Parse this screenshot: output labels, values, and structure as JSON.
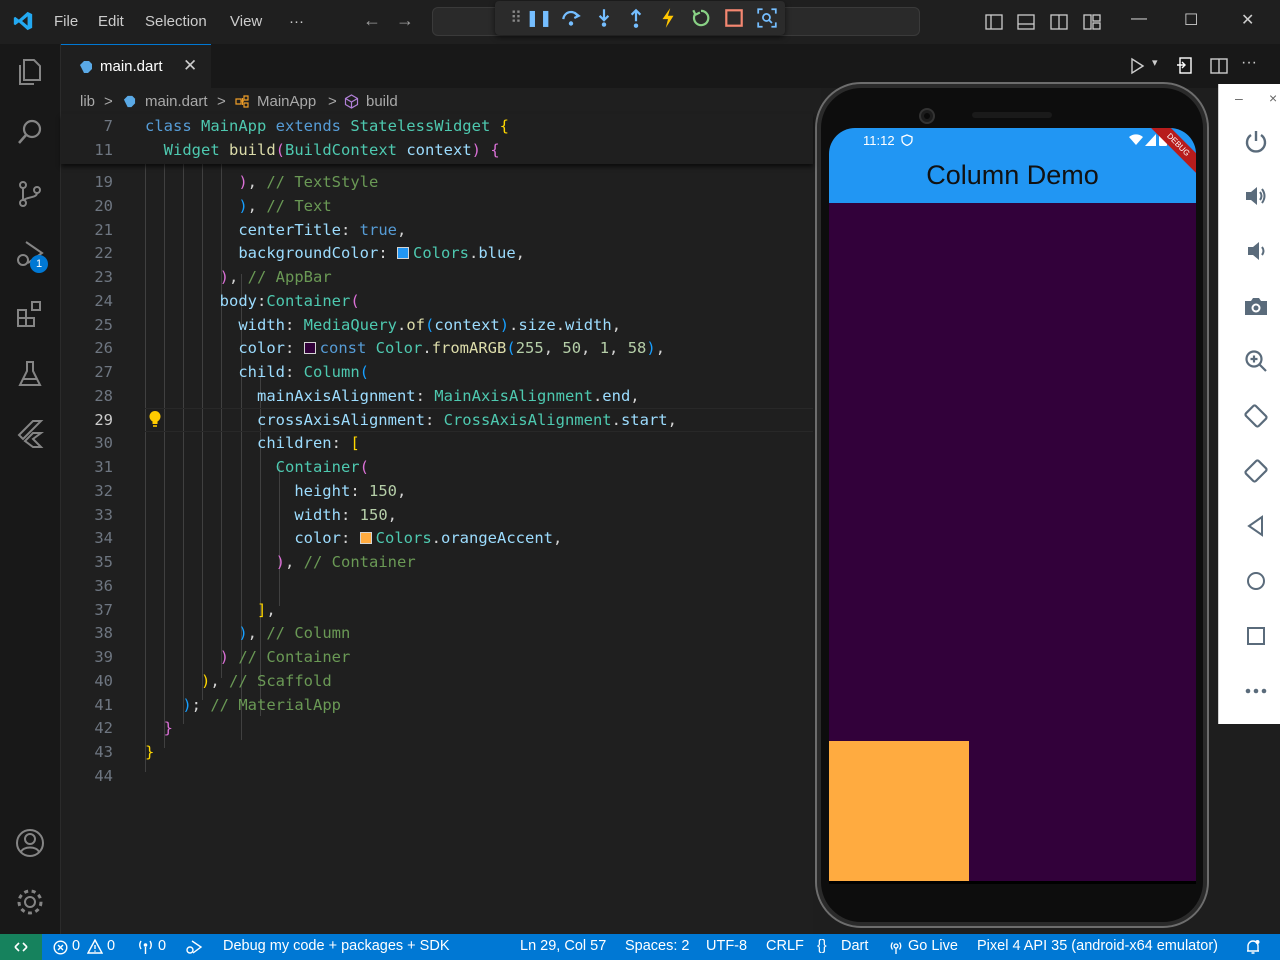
{
  "window": {
    "menu": [
      "File",
      "Edit",
      "Selection",
      "View",
      "···"
    ]
  },
  "debug_toolbar": {
    "buttons": [
      "drag-handle",
      "pause",
      "step-over",
      "step-into",
      "step-out",
      "hot-reload",
      "hot-restart",
      "stop",
      "open-devtools"
    ]
  },
  "tab": {
    "label": "main.dart",
    "close": "✕"
  },
  "breadcrumb": {
    "parts": [
      "lib",
      ">",
      "main.dart",
      ">",
      "MainApp",
      ">",
      "build"
    ]
  },
  "editor": {
    "sticky": [
      {
        "n": "7",
        "parts": [
          [
            "kw",
            "class "
          ],
          [
            "ty",
            "MainApp "
          ],
          [
            "kw",
            "extends "
          ],
          [
            "ty",
            "StatelessWidget "
          ],
          [
            "b1",
            "{"
          ]
        ]
      },
      {
        "n": "11",
        "parts": [
          [
            "id",
            "  "
          ],
          [
            "ty",
            "Widget "
          ],
          [
            "fn",
            "build"
          ],
          [
            "b2",
            "("
          ],
          [
            "ty",
            "BuildContext "
          ],
          [
            "pr",
            "context"
          ],
          [
            "b2",
            ")"
          ],
          [
            "id",
            " "
          ],
          [
            "b2",
            "{"
          ]
        ]
      }
    ],
    "lines": [
      {
        "n": "19",
        "parts": [
          [
            "id",
            "          "
          ],
          [
            "b2",
            ")"
          ],
          [
            "id",
            ", "
          ],
          [
            "cm",
            "// TextStyle"
          ]
        ]
      },
      {
        "n": "20",
        "parts": [
          [
            "id",
            "          "
          ],
          [
            "b3",
            ")"
          ],
          [
            "id",
            ", "
          ],
          [
            "cm",
            "// Text"
          ]
        ]
      },
      {
        "n": "21",
        "parts": [
          [
            "id",
            "          "
          ],
          [
            "pr",
            "centerTitle"
          ],
          [
            "id",
            ": "
          ],
          [
            "kw",
            "true"
          ],
          [
            "id",
            ","
          ]
        ]
      },
      {
        "n": "22",
        "parts": [
          [
            "id",
            "          "
          ],
          [
            "pr",
            "backgroundColor"
          ],
          [
            "id",
            ": "
          ],
          [
            "sw",
            "#2196f3"
          ],
          [
            "ty",
            "Colors"
          ],
          [
            "id",
            "."
          ],
          [
            "pr",
            "blue"
          ],
          [
            "id",
            ","
          ]
        ]
      },
      {
        "n": "23",
        "parts": [
          [
            "id",
            "        "
          ],
          [
            "b2",
            ")"
          ],
          [
            "id",
            ", "
          ],
          [
            "cm",
            "// AppBar"
          ]
        ]
      },
      {
        "n": "24",
        "parts": [
          [
            "id",
            "        "
          ],
          [
            "pr",
            "body"
          ],
          [
            "id",
            ":"
          ],
          [
            "ty",
            "Container"
          ],
          [
            "b2",
            "("
          ]
        ]
      },
      {
        "n": "25",
        "parts": [
          [
            "id",
            "          "
          ],
          [
            "pr",
            "width"
          ],
          [
            "id",
            ": "
          ],
          [
            "ty",
            "MediaQuery"
          ],
          [
            "id",
            "."
          ],
          [
            "fn",
            "of"
          ],
          [
            "b3",
            "("
          ],
          [
            "pr",
            "context"
          ],
          [
            "b3",
            ")"
          ],
          [
            "id",
            "."
          ],
          [
            "pr",
            "size"
          ],
          [
            "id",
            "."
          ],
          [
            "pr",
            "width"
          ],
          [
            "id",
            ","
          ]
        ]
      },
      {
        "n": "26",
        "parts": [
          [
            "id",
            "          "
          ],
          [
            "pr",
            "color"
          ],
          [
            "id",
            ": "
          ],
          [
            "sw",
            "#32013a"
          ],
          [
            "kw",
            "const "
          ],
          [
            "ty",
            "Color"
          ],
          [
            "id",
            "."
          ],
          [
            "fn",
            "fromARGB"
          ],
          [
            "b3",
            "("
          ],
          [
            "nm",
            "255"
          ],
          [
            "id",
            ", "
          ],
          [
            "nm",
            "50"
          ],
          [
            "id",
            ", "
          ],
          [
            "nm",
            "1"
          ],
          [
            "id",
            ", "
          ],
          [
            "nm",
            "58"
          ],
          [
            "b3",
            ")"
          ],
          [
            "id",
            ","
          ]
        ]
      },
      {
        "n": "27",
        "parts": [
          [
            "id",
            "          "
          ],
          [
            "pr",
            "child"
          ],
          [
            "id",
            ": "
          ],
          [
            "ty",
            "Column"
          ],
          [
            "b3",
            "("
          ]
        ]
      },
      {
        "n": "28",
        "parts": [
          [
            "id",
            "            "
          ],
          [
            "pr",
            "mainAxisAlignment"
          ],
          [
            "id",
            ": "
          ],
          [
            "ty",
            "MainAxisAlignment"
          ],
          [
            "id",
            "."
          ],
          [
            "pr",
            "end"
          ],
          [
            "id",
            ","
          ]
        ]
      },
      {
        "n": "29",
        "parts": [
          [
            "id",
            "            "
          ],
          [
            "pr",
            "crossAxisAlignment"
          ],
          [
            "id",
            ": "
          ],
          [
            "ty",
            "CrossAxisAlignment"
          ],
          [
            "id",
            "."
          ],
          [
            "pr",
            "start"
          ],
          [
            "id",
            ","
          ]
        ]
      },
      {
        "n": "30",
        "parts": [
          [
            "id",
            "            "
          ],
          [
            "pr",
            "children"
          ],
          [
            "id",
            ": "
          ],
          [
            "b1",
            "["
          ]
        ]
      },
      {
        "n": "31",
        "parts": [
          [
            "id",
            "              "
          ],
          [
            "ty",
            "Container"
          ],
          [
            "b2",
            "("
          ]
        ]
      },
      {
        "n": "32",
        "parts": [
          [
            "id",
            "                "
          ],
          [
            "pr",
            "height"
          ],
          [
            "id",
            ": "
          ],
          [
            "nm",
            "150"
          ],
          [
            "id",
            ","
          ]
        ]
      },
      {
        "n": "33",
        "parts": [
          [
            "id",
            "                "
          ],
          [
            "pr",
            "width"
          ],
          [
            "id",
            ": "
          ],
          [
            "nm",
            "150"
          ],
          [
            "id",
            ","
          ]
        ]
      },
      {
        "n": "34",
        "parts": [
          [
            "id",
            "                "
          ],
          [
            "pr",
            "color"
          ],
          [
            "id",
            ": "
          ],
          [
            "sw",
            "#ffab40"
          ],
          [
            "ty",
            "Colors"
          ],
          [
            "id",
            "."
          ],
          [
            "pr",
            "orangeAccent"
          ],
          [
            "id",
            ","
          ]
        ]
      },
      {
        "n": "35",
        "parts": [
          [
            "id",
            "              "
          ],
          [
            "b2",
            ")"
          ],
          [
            "id",
            ", "
          ],
          [
            "cm",
            "// Container"
          ]
        ]
      },
      {
        "n": "36",
        "parts": []
      },
      {
        "n": "37",
        "parts": [
          [
            "id",
            "            "
          ],
          [
            "b1",
            "]"
          ],
          [
            "id",
            ","
          ]
        ]
      },
      {
        "n": "38",
        "parts": [
          [
            "id",
            "          "
          ],
          [
            "b3",
            ")"
          ],
          [
            "id",
            ", "
          ],
          [
            "cm",
            "// Column"
          ]
        ]
      },
      {
        "n": "39",
        "parts": [
          [
            "id",
            "        "
          ],
          [
            "b2",
            ")"
          ],
          [
            "id",
            " "
          ],
          [
            "cm",
            "// Container"
          ]
        ]
      },
      {
        "n": "40",
        "parts": [
          [
            "id",
            "      "
          ],
          [
            "b1",
            ")"
          ],
          [
            "id",
            ", "
          ],
          [
            "cm",
            "// Scaffold"
          ]
        ]
      },
      {
        "n": "41",
        "parts": [
          [
            "id",
            "    "
          ],
          [
            "b3",
            ")"
          ],
          [
            "id",
            "; "
          ],
          [
            "cm",
            "// MaterialApp"
          ]
        ]
      },
      {
        "n": "42",
        "parts": [
          [
            "id",
            "  "
          ],
          [
            "b2",
            "}"
          ]
        ]
      },
      {
        "n": "43",
        "parts": [
          [
            "b1",
            "}"
          ]
        ]
      },
      {
        "n": "44",
        "parts": []
      }
    ],
    "current_line": "29"
  },
  "emulator": {
    "status_time": "11:12",
    "app_title": "Column Demo",
    "debug_banner": "DEBUG",
    "body_color": "#32013a",
    "appbar_color": "#2196f3",
    "box": {
      "height": 150,
      "width": 150,
      "color": "#ffab40"
    }
  },
  "activity": {
    "debug_badge": "1"
  },
  "statusbar": {
    "errors": "0",
    "warnings": "0",
    "ports": "0",
    "debug_mode": "Debug my code + packages + SDK",
    "cursor": "Ln 29, Col 57",
    "spaces": "Spaces: 2",
    "encoding": "UTF-8",
    "eol": "CRLF",
    "language": "Dart",
    "golive": "Go Live",
    "device": "Pixel 4 API 35 (android-x64 emulator)"
  },
  "colors": {
    "accent": "#0078d4",
    "remote": "#16825d"
  }
}
